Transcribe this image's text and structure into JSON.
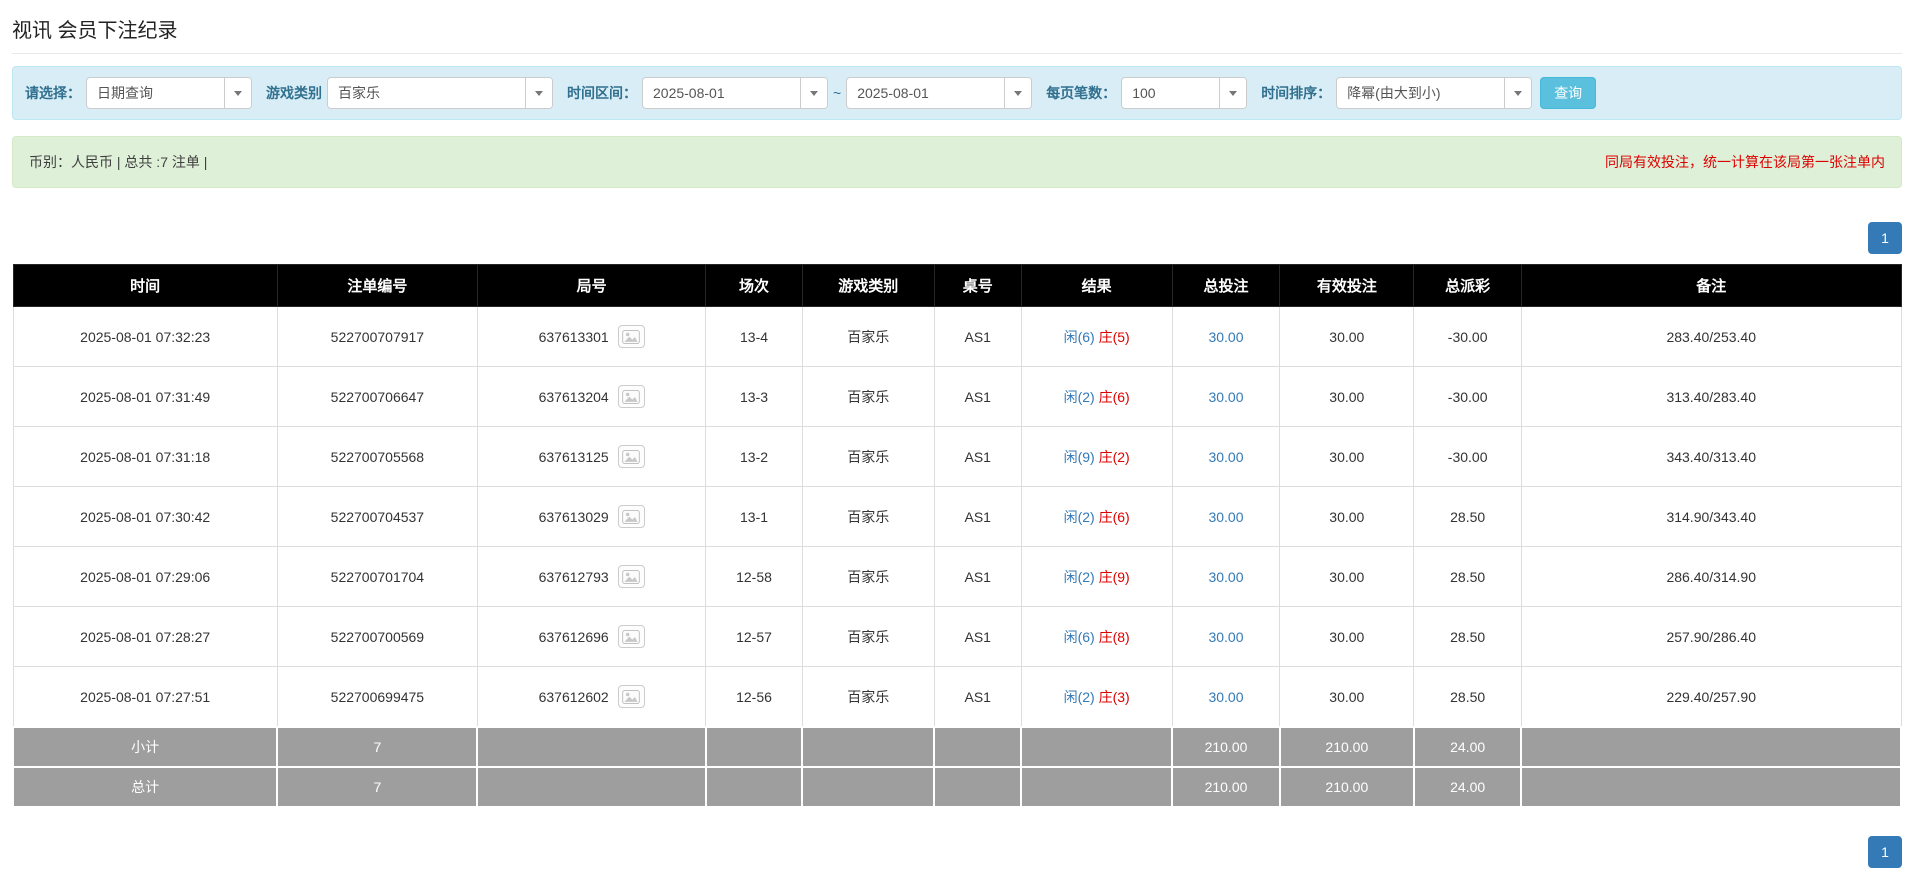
{
  "page": {
    "title": "视讯 会员下注纪录"
  },
  "filter_bar": {
    "select": {
      "label": "请选择：",
      "value": "日期查询"
    },
    "game_type": {
      "label": "游戏类别",
      "value": "百家乐"
    },
    "time_range": {
      "label": "时间区间：",
      "from": "2025-08-01",
      "separator": "~",
      "to": "2025-08-01"
    },
    "page_size": {
      "label": "每页笔数：",
      "value": "100"
    },
    "sort": {
      "label": "时间排序：",
      "value": "降幂(由大到小)"
    },
    "query_button": "查询"
  },
  "summary_bar": {
    "info": "币别：人民币 | 总共 :7 注单 |",
    "notice": "同局有效投注，统一计算在该局第一张注单内"
  },
  "pagination": {
    "current_page": "1"
  },
  "table": {
    "headers": [
      "时间",
      "注单编号",
      "局号",
      "场次",
      "游戏类别",
      "桌号",
      "结果",
      "总投注",
      "有效投注",
      "总派彩",
      "备注"
    ],
    "rows": [
      {
        "time": "2025-08-01 07:32:23",
        "bet_no": "522700707917",
        "round_no": "637613301",
        "session": "13-4",
        "game_type": "百家乐",
        "table_no": "AS1",
        "result_player": "闲(6)",
        "result_banker": "庄(5)",
        "total_bet": "30.00",
        "valid_bet": "30.00",
        "payout": "-30.00",
        "remark": "283.40/253.40"
      },
      {
        "time": "2025-08-01 07:31:49",
        "bet_no": "522700706647",
        "round_no": "637613204",
        "session": "13-3",
        "game_type": "百家乐",
        "table_no": "AS1",
        "result_player": "闲(2)",
        "result_banker": "庄(6)",
        "total_bet": "30.00",
        "valid_bet": "30.00",
        "payout": "-30.00",
        "remark": "313.40/283.40"
      },
      {
        "time": "2025-08-01 07:31:18",
        "bet_no": "522700705568",
        "round_no": "637613125",
        "session": "13-2",
        "game_type": "百家乐",
        "table_no": "AS1",
        "result_player": "闲(9)",
        "result_banker": "庄(2)",
        "total_bet": "30.00",
        "valid_bet": "30.00",
        "payout": "-30.00",
        "remark": "343.40/313.40"
      },
      {
        "time": "2025-08-01 07:30:42",
        "bet_no": "522700704537",
        "round_no": "637613029",
        "session": "13-1",
        "game_type": "百家乐",
        "table_no": "AS1",
        "result_player": "闲(2)",
        "result_banker": "庄(6)",
        "total_bet": "30.00",
        "valid_bet": "30.00",
        "payout": "28.50",
        "remark": "314.90/343.40"
      },
      {
        "time": "2025-08-01 07:29:06",
        "bet_no": "522700701704",
        "round_no": "637612793",
        "session": "12-58",
        "game_type": "百家乐",
        "table_no": "AS1",
        "result_player": "闲(2)",
        "result_banker": "庄(9)",
        "total_bet": "30.00",
        "valid_bet": "30.00",
        "payout": "28.50",
        "remark": "286.40/314.90"
      },
      {
        "time": "2025-08-01 07:28:27",
        "bet_no": "522700700569",
        "round_no": "637612696",
        "session": "12-57",
        "game_type": "百家乐",
        "table_no": "AS1",
        "result_player": "闲(6)",
        "result_banker": "庄(8)",
        "total_bet": "30.00",
        "valid_bet": "30.00",
        "payout": "28.50",
        "remark": "257.90/286.40"
      },
      {
        "time": "2025-08-01 07:27:51",
        "bet_no": "522700699475",
        "round_no": "637612602",
        "session": "12-56",
        "game_type": "百家乐",
        "table_no": "AS1",
        "result_player": "闲(2)",
        "result_banker": "庄(3)",
        "total_bet": "30.00",
        "valid_bet": "30.00",
        "payout": "28.50",
        "remark": "229.40/257.90"
      }
    ],
    "footer_rows": [
      {
        "label": "小计",
        "count": "7",
        "total_bet": "210.00",
        "valid_bet": "210.00",
        "payout": "24.00"
      },
      {
        "label": "总计",
        "count": "7",
        "total_bet": "210.00",
        "valid_bet": "210.00",
        "payout": "24.00"
      }
    ]
  },
  "icons": {
    "dropdown": "chevron-down-icon",
    "round_detail": "round-image-icon"
  },
  "colors": {
    "accent_blue": "#337ab7",
    "query_button_bg": "#5bc0de",
    "query_button_border": "#46b8da",
    "negative_red": "#dd0000",
    "filter_bar_bg": "#d9edf7",
    "filter_bar_border": "#bce8f1",
    "filter_label": "#31708f",
    "summary_bg": "#dff0d8",
    "summary_border": "#d6e9c6",
    "table_header_bg": "#000000",
    "table_footer_bg": "#9e9e9e"
  }
}
